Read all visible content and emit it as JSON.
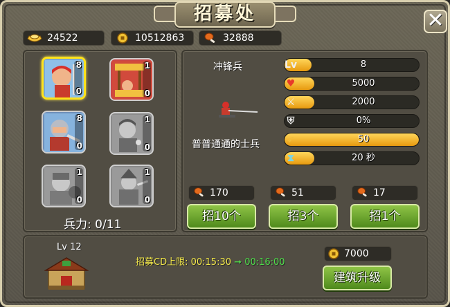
{
  "title": "招募处",
  "close_icon": "close-icon",
  "resources": [
    {
      "icon": "gold-ingot-icon",
      "value": "24522"
    },
    {
      "icon": "coin-icon",
      "value": "10512863"
    },
    {
      "icon": "meat-icon",
      "value": "32888"
    }
  ],
  "troop_slots": [
    {
      "name": "charge-soldier",
      "top": "8",
      "bottom": "0",
      "selected": true,
      "locked": false
    },
    {
      "name": "cart-soldier",
      "top": "1",
      "bottom": "0",
      "selected": false,
      "locked": false
    },
    {
      "name": "blade-soldier",
      "top": "8",
      "bottom": "0",
      "selected": false,
      "locked": false
    },
    {
      "name": "locked-soldier-1",
      "top": "1",
      "bottom": "0",
      "selected": false,
      "locked": true
    },
    {
      "name": "locked-soldier-2",
      "top": "1",
      "bottom": "0",
      "selected": false,
      "locked": true
    },
    {
      "name": "locked-soldier-3",
      "top": "1",
      "bottom": "0",
      "selected": false,
      "locked": true
    }
  ],
  "strength_label": "兵力: 0/11",
  "unit": {
    "name": "冲锋兵",
    "description": "普普通通的士兵",
    "stats": [
      {
        "icon": "level-icon",
        "icon_text": "Lv",
        "value": "8",
        "fill": 0.2
      },
      {
        "icon": "heart-icon",
        "icon_text": "♥",
        "value": "5000",
        "fill": 0.22
      },
      {
        "icon": "sword-icon",
        "icon_text": "⚔",
        "value": "2000",
        "fill": 0.22
      },
      {
        "icon": "shield-icon",
        "icon_text": "⛨",
        "value": "0%",
        "fill": 0.0
      },
      {
        "icon": "speed-icon",
        "icon_text": "➶",
        "value": "50",
        "fill": 1.0
      },
      {
        "icon": "hourglass-icon",
        "icon_text": "⧗",
        "value": "20 秒",
        "fill": 0.22
      }
    ]
  },
  "recruit": [
    {
      "cost": "170",
      "label": "招10个"
    },
    {
      "cost": "51",
      "label": "招3个"
    },
    {
      "cost": "17",
      "label": "招1个"
    }
  ],
  "building": {
    "level": "Lv 12",
    "cd_label": "招募CD上限: 00:15:30",
    "arrow": "➞",
    "cd_next": "00:16:00",
    "upgrade_cost": "7000",
    "upgrade_label": "建筑升级"
  },
  "colors": {
    "accent_gold": "#e79a10",
    "button_green": "#5f9a24",
    "highlight": "#ffe21a"
  }
}
